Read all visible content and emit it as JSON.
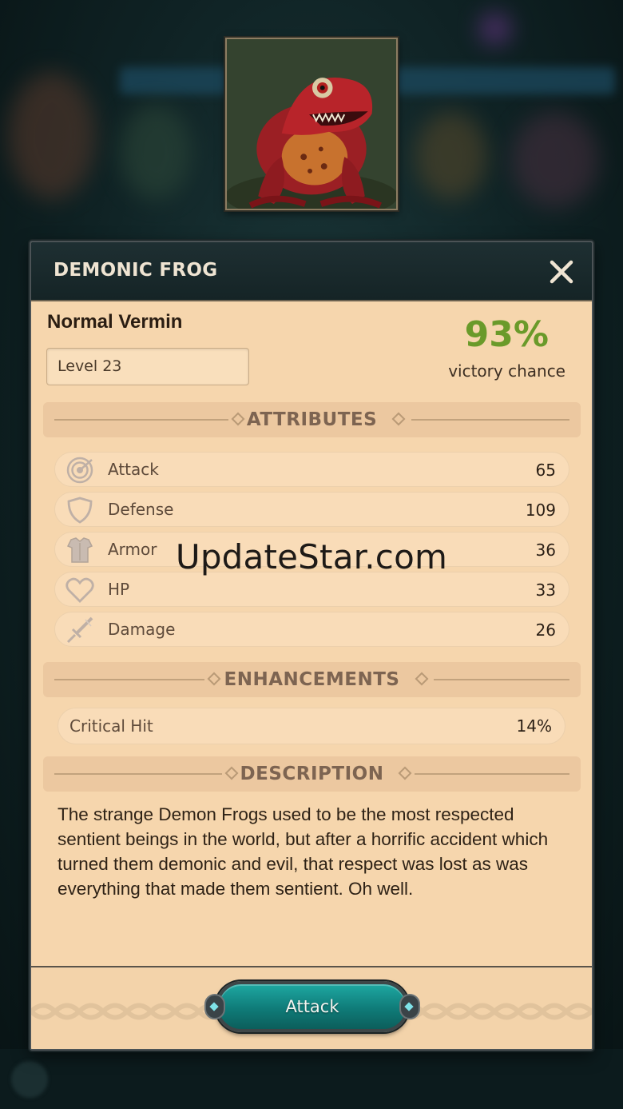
{
  "dialog": {
    "title": "DEMONIC FROG",
    "close_icon": "close-icon"
  },
  "monster": {
    "type": "Normal Vermin",
    "level": "Level 23",
    "portrait_icon": "demonic-frog-portrait"
  },
  "victory": {
    "percent": "93%",
    "label": "victory chance",
    "color": "#6a9a2a"
  },
  "sections": {
    "attributes": "ATTRIBUTES",
    "enhancements": "ENHANCEMENTS",
    "description": "DESCRIPTION"
  },
  "attributes": [
    {
      "label": "Attack",
      "value": "65",
      "icon": "target-icon"
    },
    {
      "label": "Defense",
      "value": "109",
      "icon": "shield-icon"
    },
    {
      "label": "Armor",
      "value": "36",
      "icon": "armor-icon"
    },
    {
      "label": "HP",
      "value": "33",
      "icon": "heart-icon"
    },
    {
      "label": "Damage",
      "value": "26",
      "icon": "sword-icon"
    }
  ],
  "enhancements": [
    {
      "label": "Critical Hit",
      "value": "14%"
    }
  ],
  "description_text": "The strange Demon Frogs used to be the most respected sentient beings in the world, but after a horrific accident which turned them demonic and evil, that respect was lost as was everything that made them sentient.  Oh well.",
  "actions": {
    "attack_label": "Attack"
  },
  "watermark": "UpdateStar.com",
  "colors": {
    "panel": "#f6d6ad",
    "header": "#1e2f32",
    "button": "#0f7b78"
  }
}
